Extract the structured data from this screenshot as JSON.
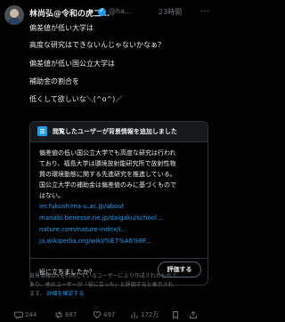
{
  "post": {
    "author_name": "林尚弘@令和の虎二…",
    "handle": "@ha…",
    "time": "23時間",
    "more": "…",
    "lines": [
      "偏差値が低い大学は",
      "高度な研究はできないんじゃないかなぁ？",
      "偏差値が低い国公立大学は",
      "補助金の割合を",
      "低くして欲しいな＼(^o^)／"
    ]
  },
  "community_note": {
    "header": "閲覧したユーザーが背景情報を追加しました",
    "body_lines": [
      "偏差値の低い国公立大学でも高度な研究は行われ",
      "ており、福島大学は環境放射能研究所で放射性物",
      "質の環境動態に関する先進研究を推進している。",
      "国公立大学の補助金は偏差値のみに基づくもので",
      "はない。"
    ],
    "links": [
      "ier.fukushima-u.ac.jp/about",
      "manabi.benesse.ne.jp/daigaku/school...",
      "nature.com/nature-index/i...",
      "ja.wikipedia.org/wiki/%E7%A6%8F..."
    ],
    "helpful_question": "役に立ちましたか？",
    "rate_button": "評価する"
  },
  "footer": {
    "line1": "背景情報はXを利用しているユーザーにより作成されたもので",
    "line2": "あり、他のユーザーが「役に立った」と評価すると表示され",
    "line3_prefix": "ます。",
    "line3_link": "詳細を確認する"
  },
  "actions": {
    "reply_count": "244",
    "retweet_count": "687",
    "like_count": "497",
    "view_count": "172万"
  },
  "colors": {
    "background": "#000000",
    "text": "#e7e9ea",
    "muted": "#71767b",
    "accent": "#1d9bf0"
  }
}
